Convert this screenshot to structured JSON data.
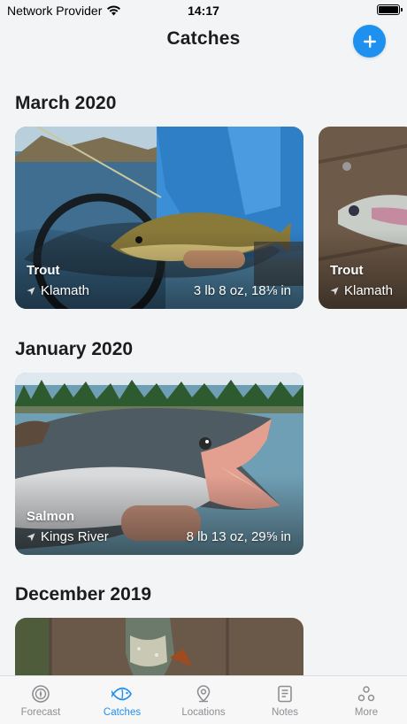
{
  "status_bar": {
    "carrier": "Network Provider",
    "time": "14:17"
  },
  "header": {
    "title": "Catches",
    "add_icon": "plus-icon"
  },
  "sections": [
    {
      "title": "March 2020",
      "catches": [
        {
          "species": "Trout",
          "location": "Klamath",
          "measure": "3 lb 8 oz, 18⅛ in"
        },
        {
          "species": "Trout",
          "location": "Klamath",
          "measure": ""
        }
      ]
    },
    {
      "title": "January 2020",
      "catches": [
        {
          "species": "Salmon",
          "location": "Kings River",
          "measure": "8 lb 13 oz, 29⅝ in"
        }
      ]
    },
    {
      "title": "December 2019",
      "catches": []
    }
  ],
  "tabs": [
    {
      "label": "Forecast",
      "icon": "compass-icon",
      "active": false
    },
    {
      "label": "Catches",
      "icon": "fish-icon",
      "active": true
    },
    {
      "label": "Locations",
      "icon": "location-pin-icon",
      "active": false
    },
    {
      "label": "Notes",
      "icon": "notes-icon",
      "active": false
    },
    {
      "label": "More",
      "icon": "more-icon",
      "active": false
    }
  ],
  "colors": {
    "accent": "#1e90f0",
    "background": "#f3f4f6",
    "tab_inactive": "#8e8e93"
  }
}
